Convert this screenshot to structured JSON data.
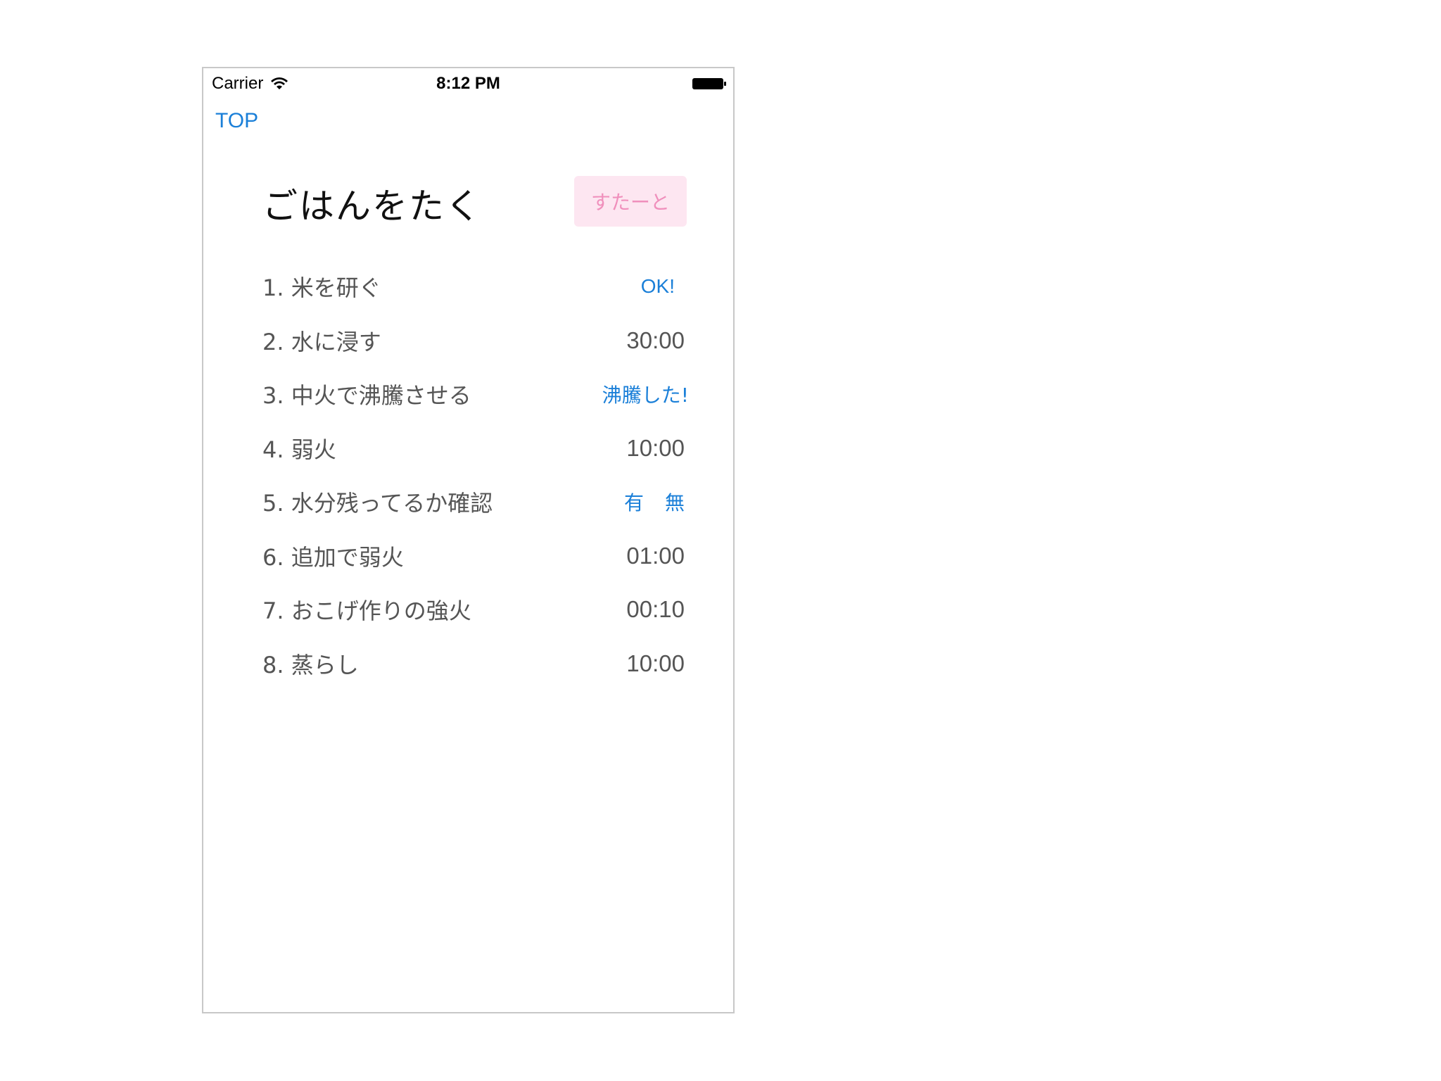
{
  "status_bar": {
    "carrier": "Carrier",
    "time": "8:12 PM"
  },
  "nav": {
    "back_label": "TOP"
  },
  "header": {
    "title": "ごはんをたく",
    "start_label": "すたーと"
  },
  "steps": [
    {
      "label": "1. 米を研ぐ",
      "action": "OK!"
    },
    {
      "label": "2. 水に浸す",
      "time": "30:00"
    },
    {
      "label": "3. 中火で沸騰させる",
      "action": "沸騰した!"
    },
    {
      "label": "4. 弱火",
      "time": "10:00"
    },
    {
      "label": "5. 水分残ってるか確認",
      "action_yes": "有",
      "action_no": "無"
    },
    {
      "label": "6. 追加で弱火",
      "time": "01:00"
    },
    {
      "label": "7. おこげ作りの強火",
      "time": "00:10"
    },
    {
      "label": "8. 蒸らし",
      "time": "10:00"
    }
  ],
  "colors": {
    "link": "#1a7fd8",
    "start_bg": "#fde6f1",
    "start_text": "#f08fbc"
  }
}
